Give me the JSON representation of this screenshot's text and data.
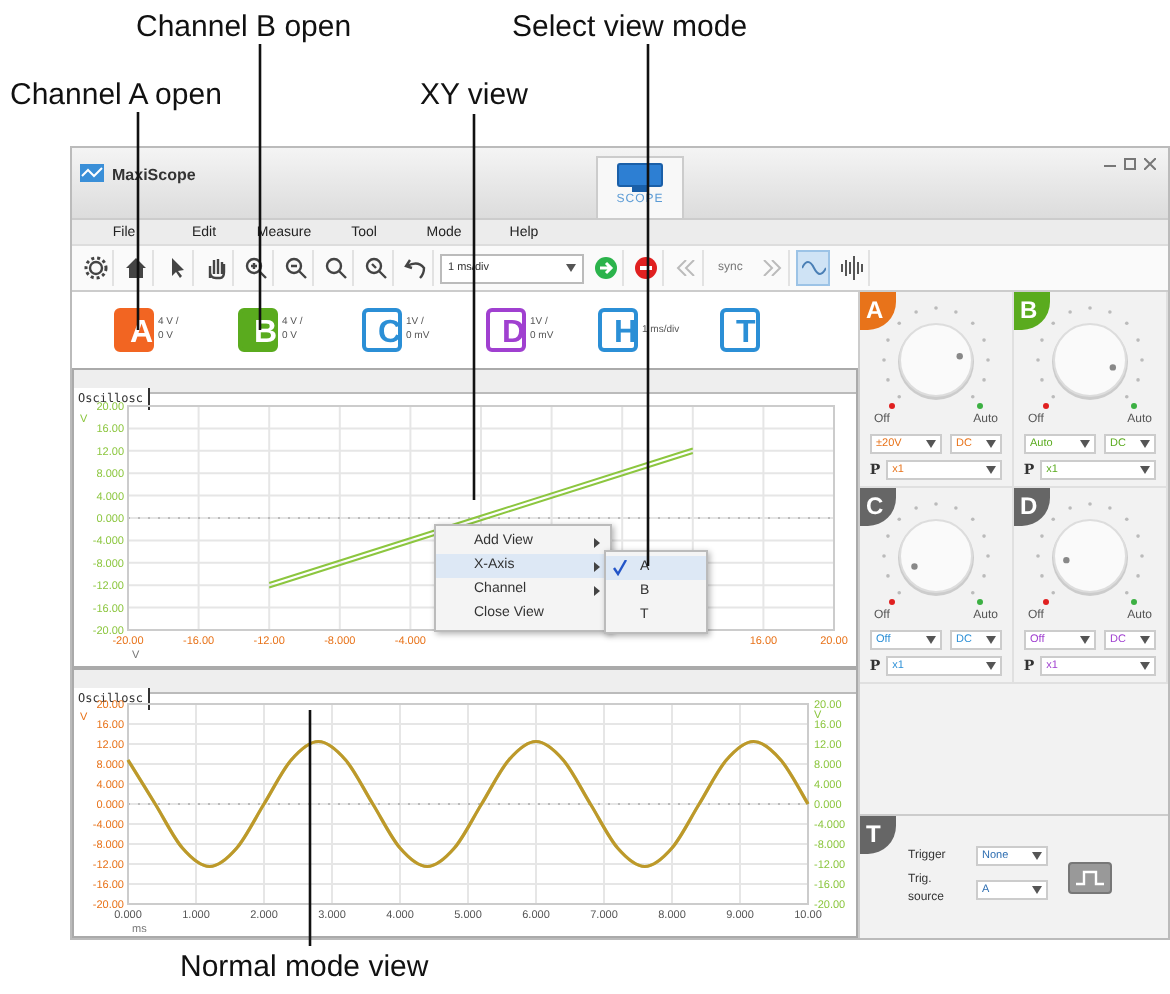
{
  "callouts": [
    {
      "text": "Channel B open"
    },
    {
      "text": "Select view mode"
    },
    {
      "text": "Channel A open"
    },
    {
      "text": "XY view"
    },
    {
      "text": "Normal mode view"
    }
  ],
  "window": {
    "title": "MaxiScope",
    "tab": "SCOPE"
  },
  "menu": [
    "File",
    "Edit",
    "Measure",
    "Tool",
    "Mode",
    "Help"
  ],
  "toolbar": {
    "timebase": "1 ms/div",
    "sync": "sync",
    "views": [
      {
        "selected": true
      },
      {
        "selected": false
      }
    ]
  },
  "channels": [
    {
      "label": "A",
      "open": true,
      "color": "#f26522",
      "scale": "4 V /",
      "offset": "0 V"
    },
    {
      "label": "B",
      "open": true,
      "color": "#5aab1e",
      "scale": "4 V /",
      "offset": "0 V"
    },
    {
      "label": "C",
      "open": false,
      "color": "#2b8fd6",
      "scale": "1V /",
      "offset": "0 mV"
    },
    {
      "label": "D",
      "open": false,
      "color": "#a040d0",
      "scale": "1V /",
      "offset": "0 mV"
    },
    {
      "label": "H",
      "open": false,
      "color": "#2b8fd6",
      "scale": "1 ms/div"
    },
    {
      "label": "T",
      "open": false,
      "color": "#2b8fd6"
    }
  ],
  "xy_panel": {
    "tab": "Oscillosc",
    "chart_data": {
      "type": "line",
      "x": [
        -12,
        12
      ],
      "series": [
        {
          "color": "#8cc63f",
          "values": [
            -12.4,
            11.6
          ]
        },
        {
          "color": "#8cc63f",
          "values": [
            -11.6,
            12.4
          ]
        }
      ],
      "xlim": [
        -20,
        20
      ],
      "ylim": [
        -20,
        20
      ],
      "xlabel": "V",
      "ylabel": "V",
      "grid": true,
      "ref_lines": [
        {
          "axis": "y",
          "value": 0
        }
      ],
      "xticks": [
        {
          "value": -20,
          "label": "-20.00"
        },
        {
          "value": -16,
          "label": "-16.00"
        },
        {
          "value": -12,
          "label": "-12.00"
        },
        {
          "value": -8,
          "label": "-8.000"
        },
        {
          "value": -4,
          "label": "-4.000"
        },
        {
          "value": 16,
          "label": "16.00"
        },
        {
          "value": 20,
          "label": "20.00"
        }
      ],
      "yticks": [
        {
          "value": 20,
          "label": "20.00"
        },
        {
          "value": 16,
          "label": "16.00"
        },
        {
          "value": 12,
          "label": "12.00"
        },
        {
          "value": 8,
          "label": "8.000"
        },
        {
          "value": 4,
          "label": "4.000"
        },
        {
          "value": 0,
          "label": "0.000"
        },
        {
          "value": -4,
          "label": "-4.000"
        },
        {
          "value": -8,
          "label": "-8.000"
        },
        {
          "value": -12,
          "label": "-12.00"
        },
        {
          "value": -16,
          "label": "-16.00"
        },
        {
          "value": -20,
          "label": "-20.00"
        }
      ]
    }
  },
  "context_menu": {
    "items": [
      {
        "label": "Add View",
        "submenu": true,
        "selected": false
      },
      {
        "label": "X-Axis",
        "submenu": true,
        "selected": true
      },
      {
        "label": "Channel",
        "submenu": true,
        "selected": false
      },
      {
        "label": "Close View",
        "submenu": false,
        "selected": false
      }
    ],
    "submenu": [
      {
        "label": "A",
        "checked": true,
        "selected": true
      },
      {
        "label": "B",
        "checked": false,
        "selected": false
      },
      {
        "label": "T",
        "checked": false,
        "selected": false
      }
    ]
  },
  "normal_panel": {
    "tab": "Oscillosc",
    "chart_data": {
      "type": "line",
      "x": [
        0,
        0.4,
        0.8,
        1.2,
        1.6,
        2,
        2.4,
        2.8,
        3.2,
        3.6,
        4,
        4.4,
        4.8,
        5.2,
        5.6,
        6,
        6.4,
        6.8,
        7.2,
        7.6,
        8,
        8.4,
        8.8,
        9.2,
        9.6,
        10
      ],
      "series": [
        {
          "color": "#8cc63f",
          "values": [
            8.8,
            0,
            -8.8,
            -12.5,
            -8.8,
            0,
            8.8,
            12.5,
            8.8,
            0,
            -8.8,
            -12.5,
            -8.8,
            0,
            8.8,
            12.5,
            8.8,
            0,
            -8.8,
            -12.5,
            -8.8,
            0,
            8.8,
            12.5,
            8.8,
            0
          ]
        },
        {
          "color": "#e8731a",
          "values": [
            8.8,
            0,
            -8.8,
            -12.5,
            -8.8,
            0,
            8.8,
            12.5,
            8.8,
            0,
            -8.8,
            -12.5,
            -8.8,
            0,
            8.8,
            12.5,
            8.8,
            0,
            -8.8,
            -12.5,
            -8.8,
            0,
            8.8,
            12.5,
            8.8,
            0
          ]
        }
      ],
      "xlim": [
        0,
        10
      ],
      "ylim": [
        -20,
        20
      ],
      "y2lim": [
        -20,
        20
      ],
      "xlabel": "ms",
      "ylabel": "V",
      "y2label": "V",
      "grid": true,
      "ref_lines": [
        {
          "axis": "y",
          "value": 0
        }
      ],
      "xticks": [
        {
          "value": 0,
          "label": "0.000"
        },
        {
          "value": 1,
          "label": "1.000"
        },
        {
          "value": 2,
          "label": "2.000"
        },
        {
          "value": 3,
          "label": "3.000"
        },
        {
          "value": 4,
          "label": "4.000"
        },
        {
          "value": 5,
          "label": "5.000"
        },
        {
          "value": 6,
          "label": "6.000"
        },
        {
          "value": 7,
          "label": "7.000"
        },
        {
          "value": 8,
          "label": "8.000"
        },
        {
          "value": 9,
          "label": "9.000"
        },
        {
          "value": 10,
          "label": "10.00"
        }
      ],
      "yticks": [
        {
          "value": 20,
          "label": "20.00"
        },
        {
          "value": 16,
          "label": "16.00"
        },
        {
          "value": 12,
          "label": "12.00"
        },
        {
          "value": 8,
          "label": "8.000"
        },
        {
          "value": 4,
          "label": "4.000"
        },
        {
          "value": 0,
          "label": "0.000"
        },
        {
          "value": -4,
          "label": "-4.000"
        },
        {
          "value": -8,
          "label": "-8.000"
        },
        {
          "value": -12,
          "label": "-12.00"
        },
        {
          "value": -16,
          "label": "-16.00"
        },
        {
          "value": -20,
          "label": "-20.00"
        }
      ],
      "y2ticks": [
        {
          "value": 20,
          "label": "20.00"
        },
        {
          "value": 16,
          "label": "16.00"
        },
        {
          "value": 12,
          "label": "12.00"
        },
        {
          "value": 8,
          "label": "8.000"
        },
        {
          "value": 4,
          "label": "4.000"
        },
        {
          "value": 0,
          "label": "0.000"
        },
        {
          "value": -4,
          "label": "-4.000"
        },
        {
          "value": -8,
          "label": "-8.000"
        },
        {
          "value": -12,
          "label": "-12.00"
        },
        {
          "value": -16,
          "label": "-16.00"
        },
        {
          "value": -20,
          "label": "-20.00"
        }
      ]
    }
  },
  "knobs": [
    {
      "label": "A",
      "open": true,
      "color": "#e8731a",
      "off": "Off",
      "auto": "Auto",
      "range": "±20V",
      "coupling": "DC",
      "probe_label": "P",
      "probe": "x1"
    },
    {
      "label": "B",
      "open": true,
      "color": "#5aab1e",
      "off": "Off",
      "auto": "Auto",
      "range": "Auto",
      "coupling": "DC",
      "probe_label": "P",
      "probe": "x1"
    },
    {
      "label": "C",
      "open": false,
      "color": "#2b8fd6",
      "off": "Off",
      "auto": "Auto",
      "range": "Off",
      "coupling": "DC",
      "probe_label": "P",
      "probe": "x1"
    },
    {
      "label": "D",
      "open": false,
      "color": "#a040d0",
      "off": "Off",
      "auto": "Auto",
      "range": "Off",
      "coupling": "DC",
      "probe_label": "P",
      "probe": "x1"
    }
  ],
  "trigger": {
    "label": "T",
    "trigger_label": "Trigger",
    "trigger": "None",
    "source_label": "Trig. source",
    "source": "A"
  }
}
